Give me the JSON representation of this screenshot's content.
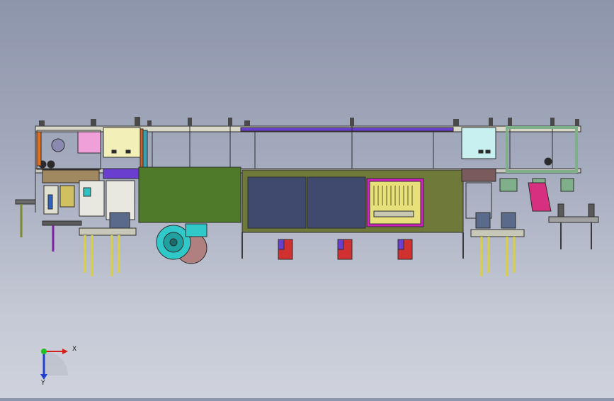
{
  "viewport": {
    "background_top": "#8d95ab",
    "background_bottom": "#cfd2dc"
  },
  "model": {
    "frame_color": "#3a3a3a",
    "panel_green": "#4f7a2a",
    "cabinet_olive": "#6f7a3a",
    "door_navy": "#3f4a6e",
    "grille_yellow": "#e8e07a",
    "grille_border": "#d020c0",
    "box_cream": "#f2efb8",
    "box_cyan": "#c8f0f0",
    "pink_block": "#f0a0d8",
    "purple_rail": "#6a3fd0",
    "orange_post": "#e07020",
    "red_motor": "#d03030",
    "blower_cyan": "#30c8c8",
    "right_frame_green": "#7fb08a"
  },
  "triad": {
    "x_label": "X",
    "y_label": "Y",
    "x_color": "#d02020",
    "y_color": "#2040d0",
    "origin_color": "#20c020"
  }
}
